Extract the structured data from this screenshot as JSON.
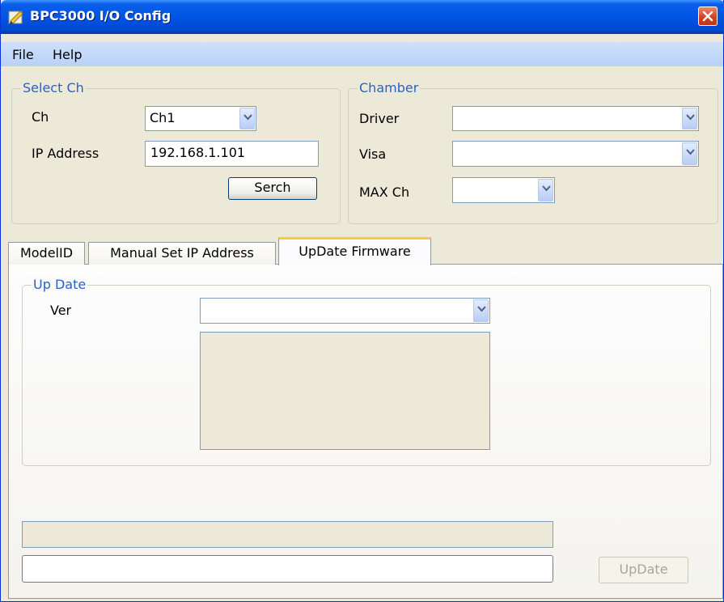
{
  "window": {
    "title": "BPC3000 I/O Config"
  },
  "icons": {
    "app": "app-icon",
    "close": "close-icon",
    "dropdown": "chevron-down-icon"
  },
  "colors": {
    "titlebar": "#0055e5",
    "group_title": "#2a61c9",
    "tab_accent": "#ffc83c",
    "close_button": "#d6431f"
  },
  "menu": {
    "items": [
      "File",
      "Help"
    ]
  },
  "select_ch": {
    "title": "Select Ch",
    "ch_label": "Ch",
    "ch_value": "Ch1",
    "ip_label": "IP Address",
    "ip_value": "192.168.1.101",
    "search_button": "Serch"
  },
  "chamber": {
    "title": "Chamber",
    "driver_label": "Driver",
    "driver_value": "",
    "visa_label": "Visa",
    "visa_value": "",
    "max_ch_label": "MAX Ch",
    "max_ch_value": ""
  },
  "tabs": [
    {
      "label": "ModelID",
      "active": false
    },
    {
      "label": "Manual Set IP Address",
      "active": false
    },
    {
      "label": "UpDate Firmware",
      "active": true
    }
  ],
  "update": {
    "group_title": "Up Date",
    "ver_label": "Ver",
    "ver_value": "",
    "status_value": "",
    "path_value": "",
    "update_button": "UpDate"
  }
}
